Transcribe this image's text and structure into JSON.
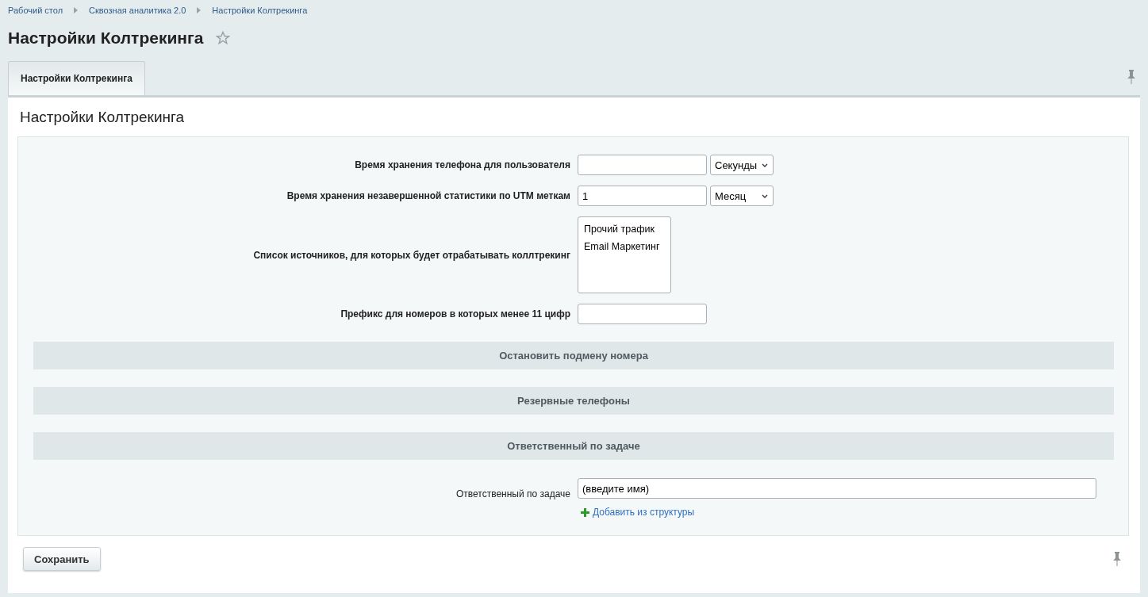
{
  "breadcrumbs": [
    "Рабочий стол",
    "Сквозная аналитика 2.0",
    "Настройки Колтрекинга"
  ],
  "title": "Настройки Колтрекинга",
  "favorite": false,
  "tabs": [
    {
      "label": "Настройки Колтрекинга",
      "selected": true
    }
  ],
  "panel_title": "Настройки Колтрекинга",
  "fields": [
    {
      "kind": "input_select",
      "label": "Время хранения телефона для пользователя",
      "unit": "Секунды"
    },
    {
      "kind": "input_select",
      "label": "Время хранения незавершенной статистики по UTM меткам",
      "value": "1",
      "unit": "Месяц"
    },
    {
      "kind": "listbox",
      "label": "Список источников, для которых будет отрабатывать коллтрекинг",
      "options": [
        "Прочий трафик",
        "Email Маркетинг"
      ]
    },
    {
      "kind": "input",
      "label": "Префикс для номеров в которых менее 11 цифр"
    }
  ],
  "sections": [
    {
      "title": "Остановить подмену номера"
    },
    {
      "title": "Резервные телефоны"
    },
    {
      "title": "Ответственный по задаче"
    }
  ],
  "responsible": {
    "label": "Ответственный по задаче",
    "value": "(введите имя)",
    "add_link": "Добавить из структуры"
  },
  "save_button": "Сохранить"
}
